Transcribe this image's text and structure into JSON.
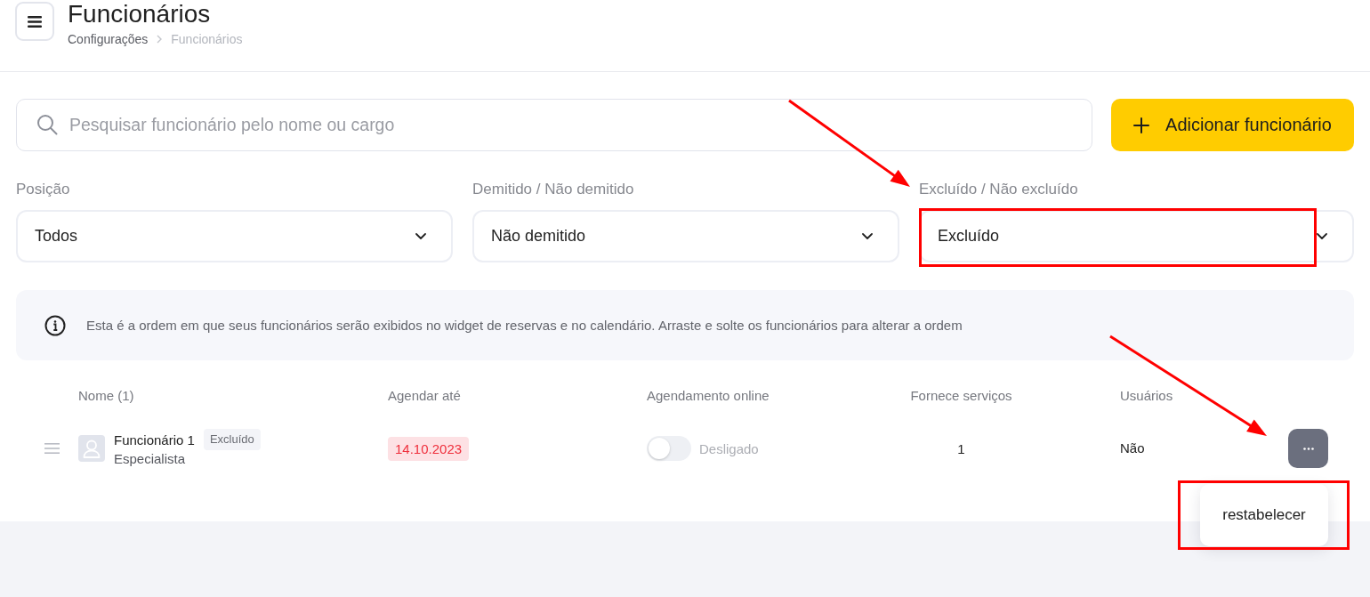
{
  "header": {
    "title": "Funcionários",
    "breadcrumb": [
      {
        "label": "Configurações",
        "current": false
      },
      {
        "label": "Funcionários",
        "current": true
      }
    ]
  },
  "toolbar": {
    "search": {
      "placeholder": "Pesquisar funcionário pelo nome ou cargo"
    },
    "add_button": "Adicionar funcionário"
  },
  "filters": [
    {
      "label": "Posição",
      "value": "Todos",
      "highlighted": false,
      "arrow": false
    },
    {
      "label": "Demitido / Não demitido",
      "value": "Não demitido",
      "highlighted": false,
      "arrow": false
    },
    {
      "label": "Excluído / Não excluído",
      "value": "Excluído",
      "highlighted": true,
      "arrow": true
    }
  ],
  "notice": "Esta é a ordem em que seus funcionários serão exibidos no widget de reservas e no calendário. Arraste e solte os funcionários para alterar a ordem",
  "table": {
    "columns": [
      "Nome (1)",
      "Agendar até",
      "Agendamento online",
      "Fornece serviços",
      "Usuários"
    ],
    "rows": [
      {
        "name": "Funcionário 1",
        "badge": "Excluído",
        "role": "Especialista",
        "book_until": "14.10.2023",
        "online_booking": {
          "on": false,
          "label": "Desligado"
        },
        "provides_services": "1",
        "users": "Não",
        "actions": {
          "arrow": true,
          "menu_open": true,
          "menu_highlighted": true,
          "menu": [
            "restabelecer"
          ]
        }
      }
    ]
  }
}
